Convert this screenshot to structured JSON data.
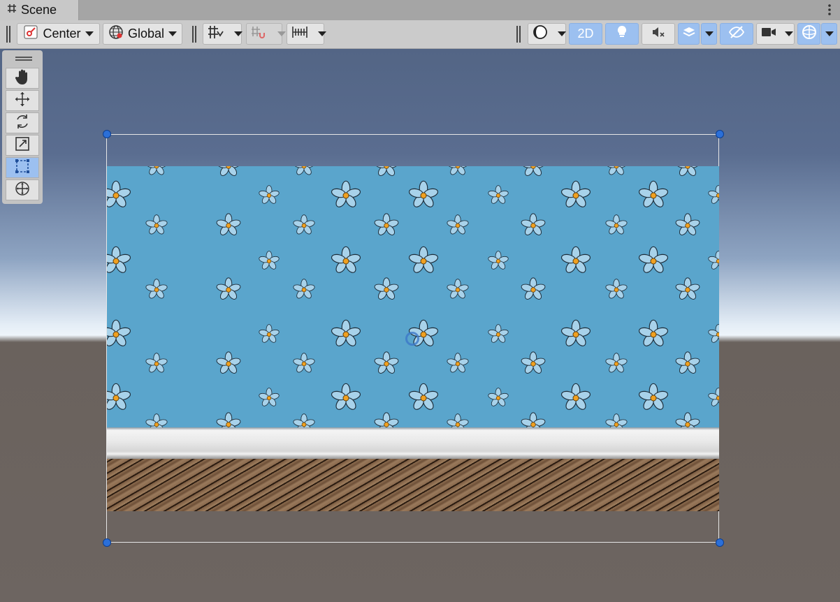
{
  "tab": {
    "title": "Scene"
  },
  "toolbar": {
    "pivot_mode": "Center",
    "pivot_rotation": "Global",
    "mode_2d": "2D"
  },
  "tools": [
    "hand-tool",
    "move-tool",
    "rotate-tool",
    "scale-tool",
    "rect-tool",
    "transform-tool"
  ],
  "colors": {
    "accent": "#9cc0f0",
    "wallpaper": "#5aa5cc",
    "handle": "#2b6fd8"
  }
}
